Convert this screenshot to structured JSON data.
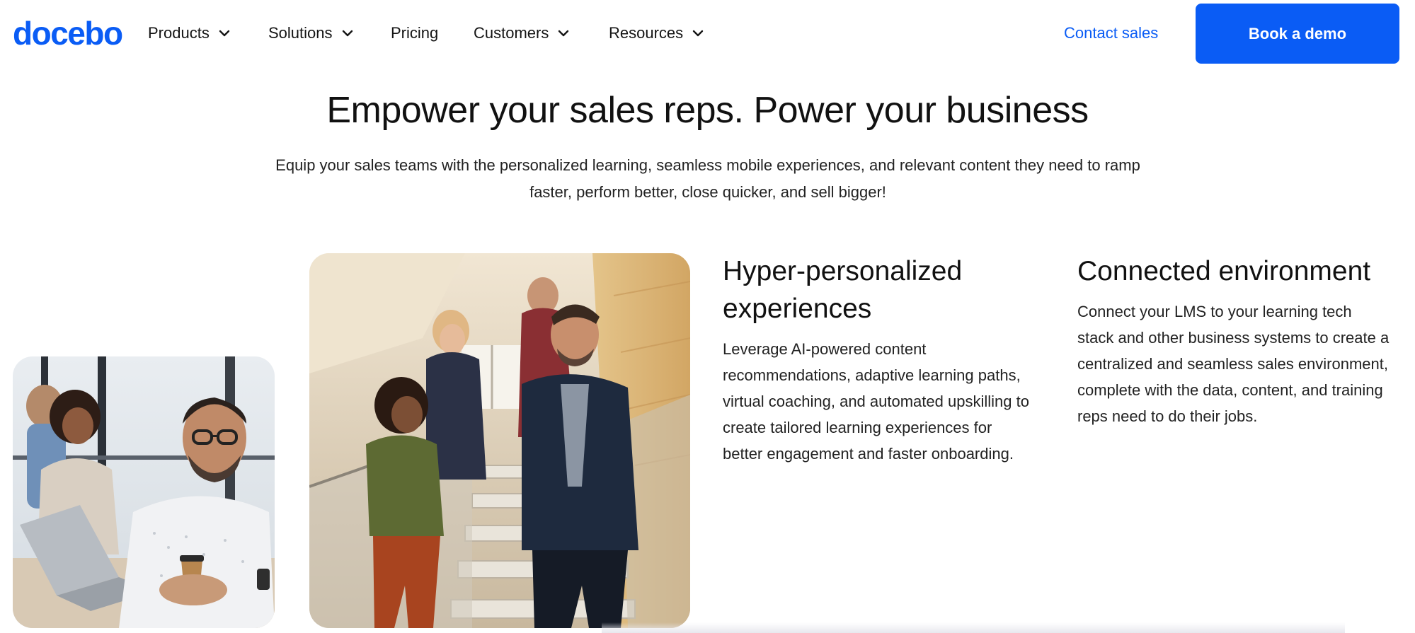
{
  "brand": {
    "logo_text": "docebo",
    "accent_color": "#0a5cf5"
  },
  "nav": {
    "items": [
      {
        "label": "Products",
        "has_dropdown": true
      },
      {
        "label": "Solutions",
        "has_dropdown": true
      },
      {
        "label": "Pricing",
        "has_dropdown": false
      },
      {
        "label": "Customers",
        "has_dropdown": true
      },
      {
        "label": "Resources",
        "has_dropdown": true
      }
    ],
    "contact_label": "Contact sales",
    "demo_label": "Book a demo"
  },
  "hero": {
    "title": "Empower your sales reps. Power your business",
    "subtitle_line1": "Equip your sales teams with the personalized learning, seamless mobile experiences, and relevant content they need to ramp",
    "subtitle_line2": "faster, perform better, close quicker, and sell bigger!"
  },
  "features": [
    {
      "title_line1": "Hyper-personalized",
      "title_line2": "experiences",
      "text_lines": [
        "Leverage AI-powered content",
        "recommendations, adaptive learning paths,",
        "virtual coaching, and automated upskilling to",
        "create tailored learning experiences for",
        "better engagement and faster onboarding."
      ]
    },
    {
      "title_line1": "Connected environment",
      "text_lines": [
        "Connect your LMS to your learning tech",
        "stack and other business systems to create a",
        "centralized and seamless sales environment,",
        "complete with the data, content, and training",
        "reps need to do their jobs."
      ]
    }
  ],
  "images": {
    "left": "office-photo",
    "middle": "stairs-photo"
  }
}
